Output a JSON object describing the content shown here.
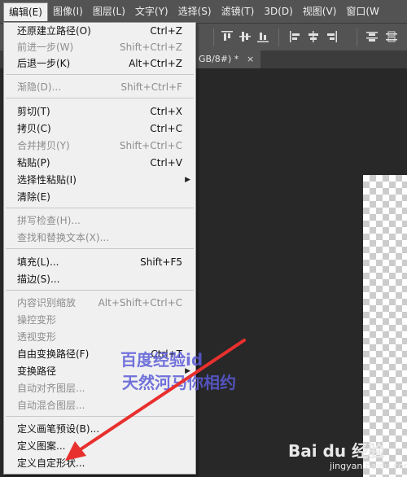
{
  "menubar": {
    "items": [
      {
        "label": "编辑(E)"
      },
      {
        "label": "图像(I)"
      },
      {
        "label": "图层(L)"
      },
      {
        "label": "文字(Y)"
      },
      {
        "label": "选择(S)"
      },
      {
        "label": "滤镜(T)"
      },
      {
        "label": "3D(D)"
      },
      {
        "label": "视图(V)"
      },
      {
        "label": "窗口(W"
      }
    ]
  },
  "tab": {
    "title": "GB/8#) *",
    "close_glyph": "×"
  },
  "edit_menu": {
    "items": [
      {
        "label": "还原建立路径(O)",
        "shortcut": "Ctrl+Z"
      },
      {
        "label": "前进一步(W)",
        "shortcut": "Shift+Ctrl+Z"
      },
      {
        "label": "后退一步(K)",
        "shortcut": "Alt+Ctrl+Z"
      },
      {
        "label": "渐隐(D)...",
        "shortcut": "Shift+Ctrl+F"
      },
      {
        "label": "剪切(T)",
        "shortcut": "Ctrl+X"
      },
      {
        "label": "拷贝(C)",
        "shortcut": "Ctrl+C"
      },
      {
        "label": "合并拷贝(Y)",
        "shortcut": "Shift+Ctrl+C"
      },
      {
        "label": "粘贴(P)",
        "shortcut": "Ctrl+V"
      },
      {
        "label": "选择性粘贴(I)",
        "shortcut": "",
        "submenu_arrow": "▶"
      },
      {
        "label": "清除(E)",
        "shortcut": ""
      },
      {
        "label": "拼写检查(H)...",
        "shortcut": ""
      },
      {
        "label": "查找和替换文本(X)...",
        "shortcut": ""
      },
      {
        "label": "填充(L)...",
        "shortcut": "Shift+F5"
      },
      {
        "label": "描边(S)...",
        "shortcut": ""
      },
      {
        "label": "内容识别缩放",
        "shortcut": "Alt+Shift+Ctrl+C"
      },
      {
        "label": "操控变形",
        "shortcut": ""
      },
      {
        "label": "透视变形",
        "shortcut": ""
      },
      {
        "label": "自由变换路径(F)",
        "shortcut": "Ctrl+T"
      },
      {
        "label": "变换路径",
        "shortcut": "",
        "submenu_arrow": "▶"
      },
      {
        "label": "自动对齐图层...",
        "shortcut": ""
      },
      {
        "label": "自动混合图层...",
        "shortcut": ""
      },
      {
        "label": "定义画笔预设(B)...",
        "shortcut": ""
      },
      {
        "label": "定义图案...",
        "shortcut": ""
      },
      {
        "label": "定义自定形状...",
        "shortcut": ""
      }
    ]
  },
  "watermark": {
    "line1": "百度经验id",
    "line2": "天然河马你相约",
    "baidu_logo": "Bai du 经验",
    "baidu_url": "jingyan.baidu.com"
  },
  "colors": {
    "menubar_bg": "#535353",
    "workspace_bg": "#282828",
    "menu_bg": "#f0f0f0",
    "disabled_text": "#8d8d8d",
    "arrow_red": "#e8302e",
    "watermark_blue": "#5b5bd8"
  },
  "icons": {
    "toolbar": [
      "align-top-icon",
      "align-vcenter-icon",
      "align-bottom-icon",
      "align-left-icon",
      "align-hcenter-icon",
      "align-right-icon",
      "distribute-top-icon",
      "distribute-vcenter-icon"
    ]
  }
}
